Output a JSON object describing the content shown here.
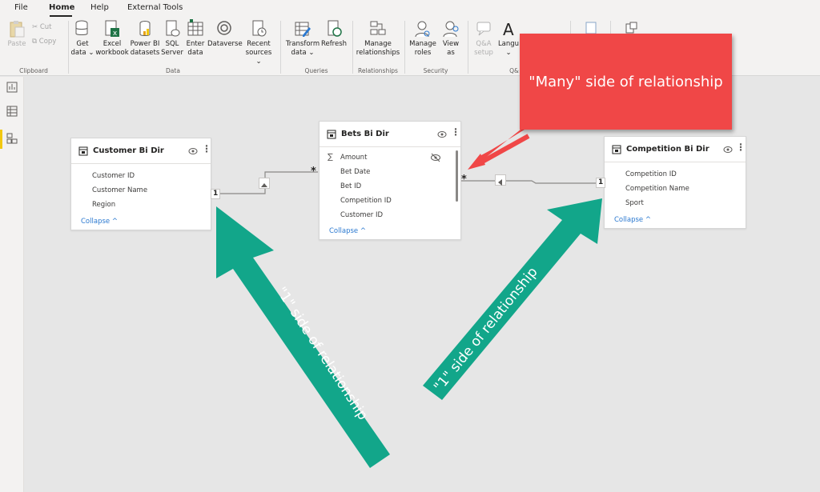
{
  "menu": {
    "file": "File",
    "home": "Home",
    "help": "Help",
    "external_tools": "External Tools"
  },
  "ribbon": {
    "clipboard": {
      "paste": "Paste",
      "cut": "Cut",
      "copy": "Copy",
      "group": "Clipboard"
    },
    "data": {
      "get_data_1": "Get",
      "get_data_2": "data ⌄",
      "excel_1": "Excel",
      "excel_2": "workbook",
      "pbi_1": "Power BI",
      "pbi_2": "datasets",
      "sql_1": "SQL",
      "sql_2": "Server",
      "enter_1": "Enter",
      "enter_2": "data",
      "dataverse": "Dataverse",
      "recent_1": "Recent",
      "recent_2": "sources ⌄",
      "group": "Data"
    },
    "queries": {
      "transform_1": "Transform",
      "transform_2": "data ⌄",
      "refresh": "Refresh",
      "group": "Queries"
    },
    "relationships": {
      "manage_1": "Manage",
      "manage_2": "relationships",
      "group": "Relationships"
    },
    "security": {
      "manage_roles_1": "Manage",
      "manage_roles_2": "roles",
      "view_as_1": "View",
      "view_as_2": "as",
      "group": "Security"
    },
    "qa": {
      "setup_1": "Q&A",
      "setup_2": "setup",
      "language_1": "Langu",
      "language_2": "⌄",
      "group": "Q&"
    }
  },
  "tables": {
    "customer": {
      "title": "Customer Bi Dir",
      "fields": [
        "Customer ID",
        "Customer Name",
        "Region"
      ],
      "collapse": "Collapse ^"
    },
    "bets": {
      "title": "Bets Bi Dir",
      "fields": [
        "Amount",
        "Bet Date",
        "Bet ID",
        "Competition ID",
        "Customer ID"
      ],
      "collapse": "Collapse ^",
      "sigma": "∑"
    },
    "competition": {
      "title": "Competition Bi Dir",
      "fields": [
        "Competition ID",
        "Competition Name",
        "Sport"
      ],
      "collapse": "Collapse ^"
    }
  },
  "relationship_labels": {
    "one": "1",
    "many": "*"
  },
  "annotations": {
    "many": "\"Many\" side of relationship",
    "one_left": "\"1\" side of relationship",
    "one_right": "\"1\" side of relationship"
  },
  "colors": {
    "callout_red": "#f04747",
    "arrow_green": "#12a68a",
    "accent_yellow": "#f2c811",
    "link_blue": "#2b79d0"
  }
}
